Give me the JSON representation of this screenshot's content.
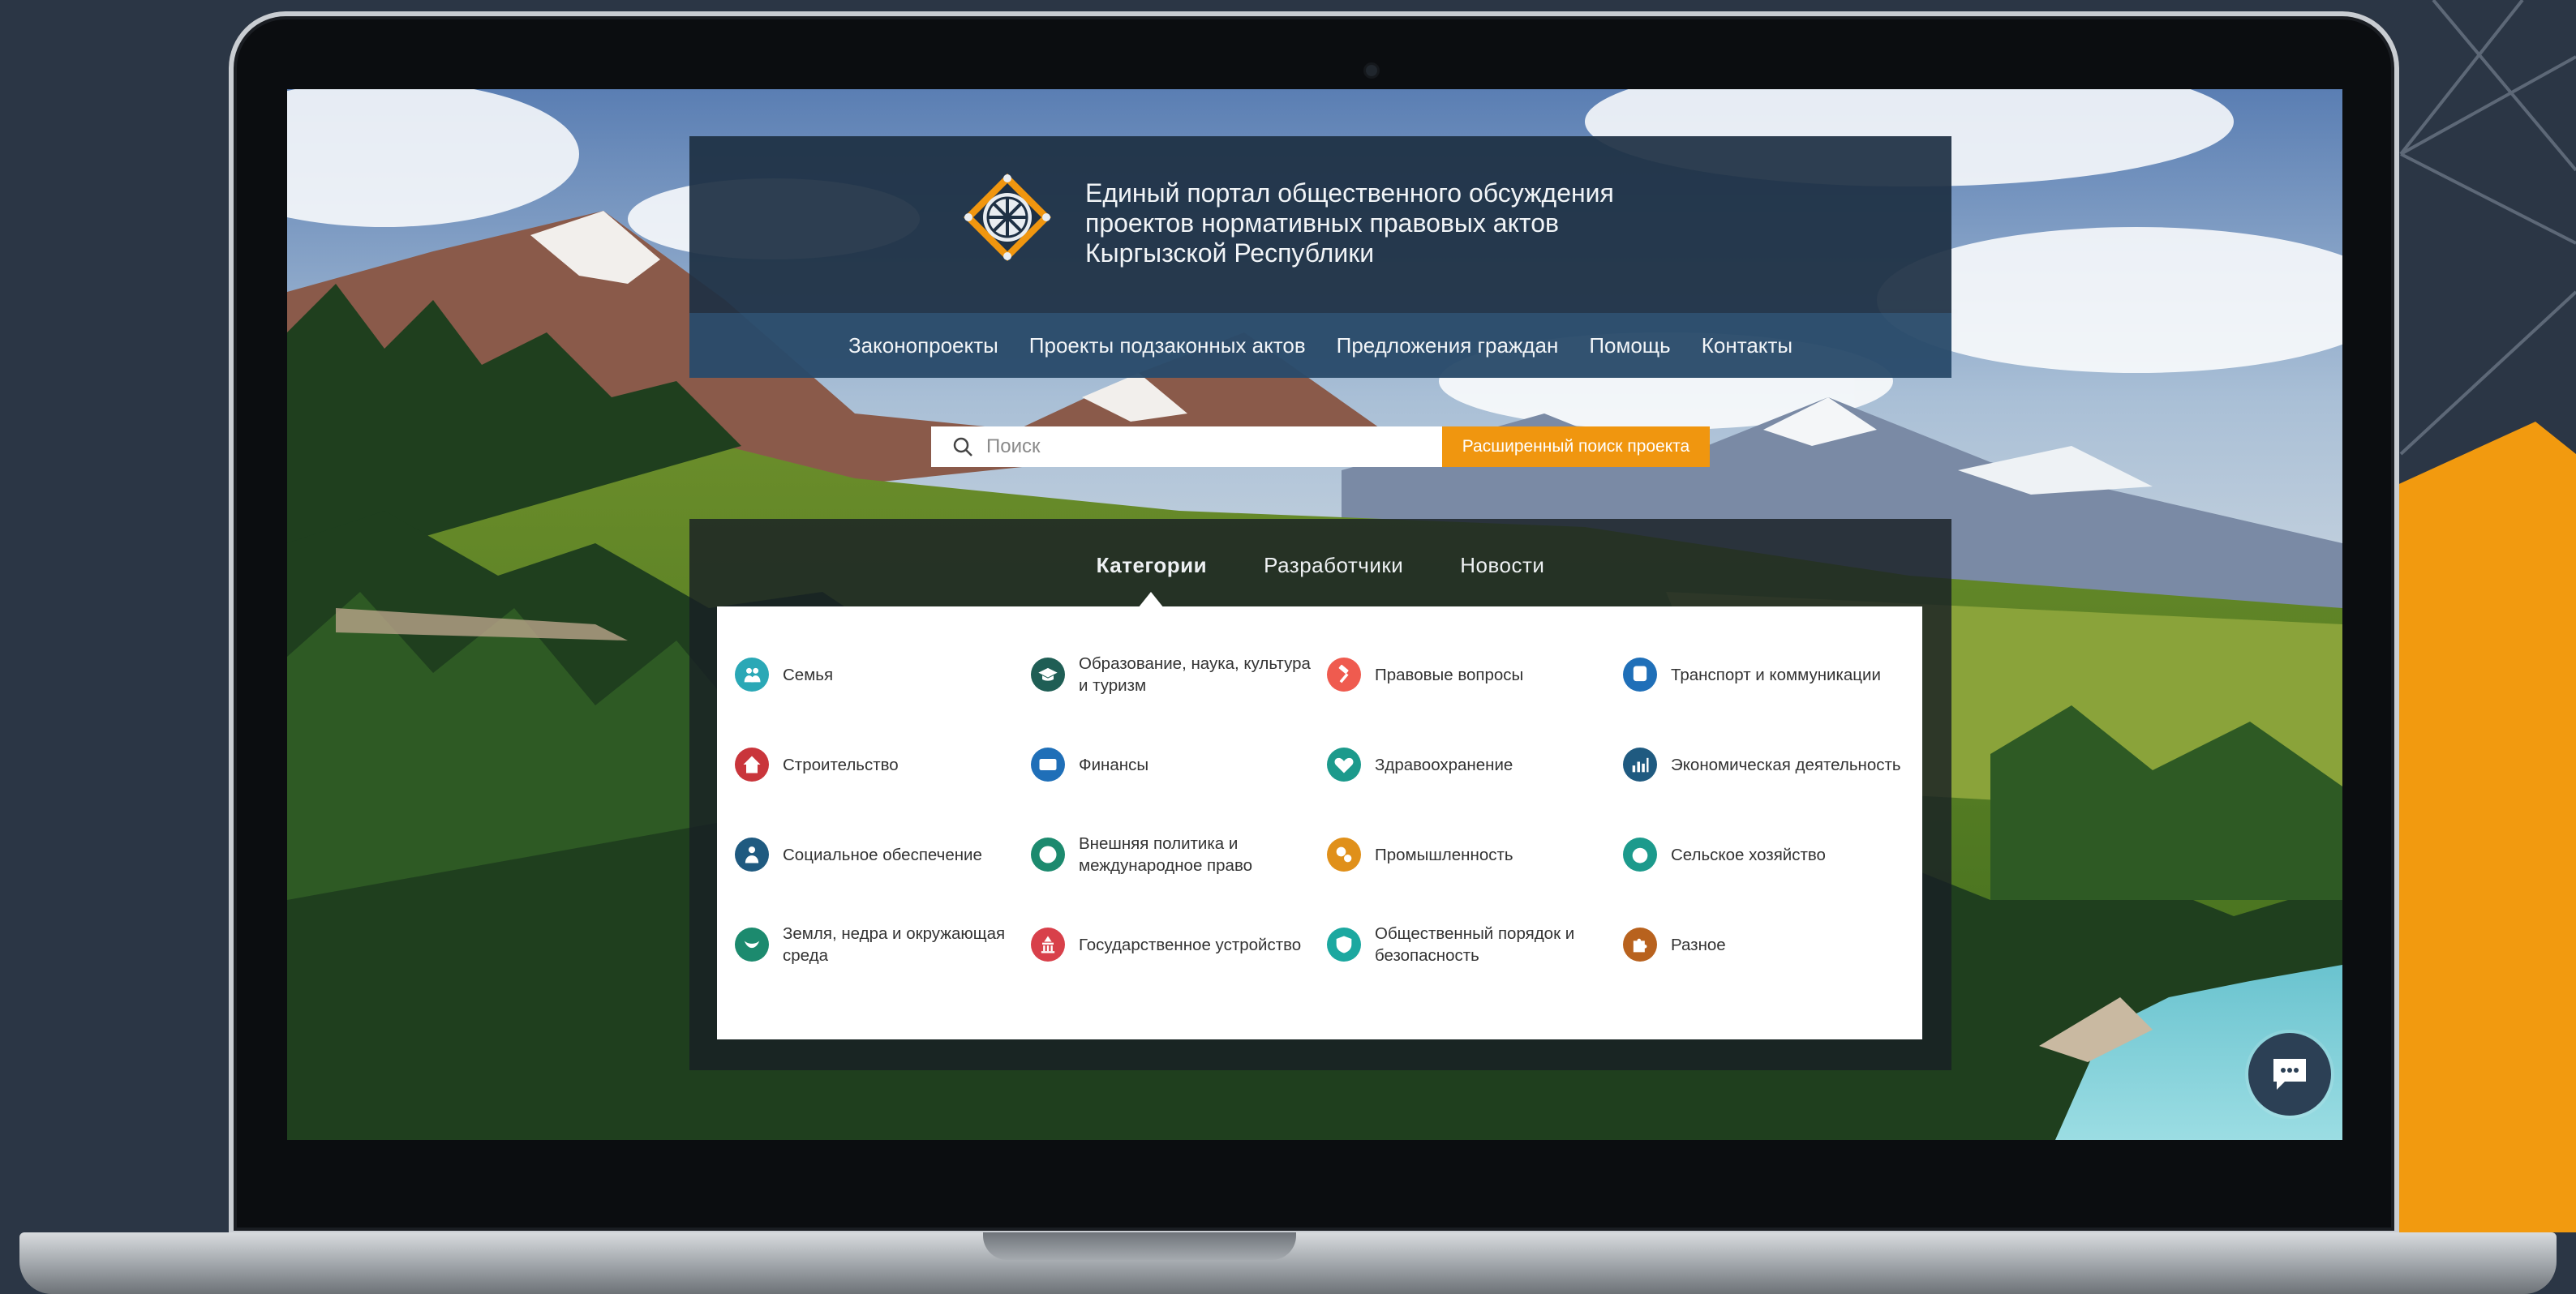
{
  "colors": {
    "background": "#2b3645",
    "accent_orange": "#f0960f",
    "header_bg": "#1e3044",
    "nav_bg": "#2a4b6a"
  },
  "header": {
    "logo_icon": "portal-emblem-icon",
    "title_lines": [
      "Единый портал общественного обсуждения",
      "проектов нормативных правовых актов",
      "Кыргызской Республики"
    ]
  },
  "nav": [
    {
      "label": "Законопроекты"
    },
    {
      "label": "Проекты подзаконных актов"
    },
    {
      "label": "Предложения граждан"
    },
    {
      "label": "Помощь"
    },
    {
      "label": "Контакты"
    }
  ],
  "search": {
    "icon": "search-icon",
    "placeholder": "Поиск",
    "advanced_label": "Расширенный поиск проекта"
  },
  "tabs": [
    {
      "label": "Категории",
      "active": true
    },
    {
      "label": "Разработчики",
      "active": false
    },
    {
      "label": "Новости",
      "active": false
    }
  ],
  "categories": [
    {
      "label": "Семья",
      "icon": "family-icon",
      "color": "#2aa8b6"
    },
    {
      "label": "Образование, наука, культура и туризм",
      "icon": "graduation-cap-icon",
      "color": "#1f5e55"
    },
    {
      "label": "Правовые вопросы",
      "icon": "gavel-icon",
      "color": "#ef5b4f"
    },
    {
      "label": "Транспорт и коммуникации",
      "icon": "bus-icon",
      "color": "#1f6fb8"
    },
    {
      "label": "Строительство",
      "icon": "house-icon",
      "color": "#c9353b"
    },
    {
      "label": "Финансы",
      "icon": "credit-card-icon",
      "color": "#1f6fb8"
    },
    {
      "label": "Здравоохранение",
      "icon": "heart-pulse-icon",
      "color": "#1c9a8c"
    },
    {
      "label": "Экономическая деятельность",
      "icon": "bar-chart-icon",
      "color": "#1f5a80"
    },
    {
      "label": "Социальное обеспечение",
      "icon": "social-security-icon",
      "color": "#1f5a80"
    },
    {
      "label": "Внешняя политика и международное право",
      "icon": "globe-icon",
      "color": "#1c8a6e"
    },
    {
      "label": "Промышленность",
      "icon": "gears-icon",
      "color": "#e0901a"
    },
    {
      "label": "Сельское хозяйство",
      "icon": "agriculture-icon",
      "color": "#1c9a8c"
    },
    {
      "label": "Земля, недра и окружающая среда",
      "icon": "leaf-icon",
      "color": "#1c8a6e"
    },
    {
      "label": "Государственное устройство",
      "icon": "government-icon",
      "color": "#d8404a"
    },
    {
      "label": "Общественный порядок и безопасность",
      "icon": "shield-icon",
      "color": "#1ca8a0"
    },
    {
      "label": "Разное",
      "icon": "puzzle-icon",
      "color": "#b8621e"
    }
  ],
  "chat": {
    "icon": "chat-bubble-icon"
  }
}
